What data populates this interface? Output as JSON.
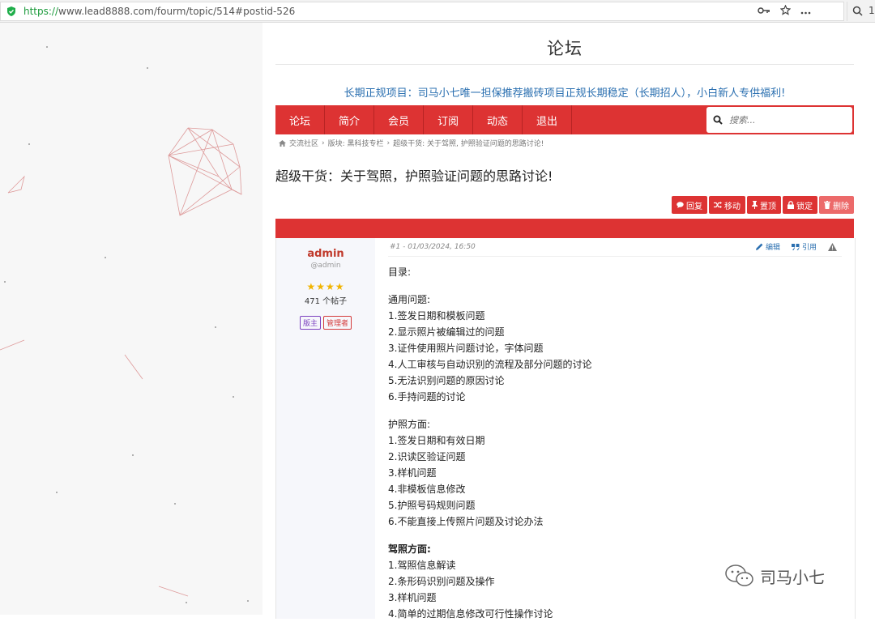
{
  "browser": {
    "url_proto": "https://",
    "url_rest": "www.lead8888.com/fourm/topic/514#postid-526",
    "right_char": "1"
  },
  "site": {
    "title": "论坛",
    "banner": "长期正规项目：司马小七唯一担保推荐搬砖项目正规长期稳定（长期招人），小白新人专供福利!"
  },
  "nav": {
    "items": [
      "论坛",
      "简介",
      "会员",
      "订阅",
      "动态",
      "退出"
    ],
    "search_placeholder": "搜索..."
  },
  "breadcrumb": {
    "home": "交流社区",
    "board": "版块: 黑科技专栏",
    "topic": "超级干货: 关于驾照, 护照验证问题的思路讨论!"
  },
  "topic": {
    "title": "超级干货：关于驾照，护照验证问题的思路讨论!"
  },
  "actions": {
    "reply": "回复",
    "move": "移动",
    "pin": "置顶",
    "lock": "锁定",
    "delete": "删除"
  },
  "author": {
    "name": "admin",
    "handle": "@admin",
    "stars": "★★★★",
    "posts": "471 个帖子",
    "badge_mod": "版主",
    "badge_admin": "管理者"
  },
  "post": {
    "meta": "#1 - 01/03/2024, 16:50",
    "edit": "编辑",
    "quote": "引用",
    "lines": {
      "toc": "目录:",
      "general_h": "通用问题:",
      "g1": "1.签发日期和模板问题",
      "g2": "2.显示照片被编辑过的问题",
      "g3": "3.证件使用照片问题讨论，字体问题",
      "g4": "4.人工审核与自动识别的流程及部分问题的讨论",
      "g5": "5.无法识别问题的原因讨论",
      "g6": "6.手持问题的讨论",
      "passport_h": "护照方面:",
      "p1": "1.签发日期和有效日期",
      "p2": "2.识读区验证问题",
      "p3": "3.样机问题",
      "p4": "4.非模板信息修改",
      "p5": "5.护照号码规则问题",
      "p6": "6.不能直接上传照片问题及讨论办法",
      "license_h": "驾照方面:",
      "l1": "1.驾照信息解读",
      "l2": "2.条形码识别问题及操作",
      "l3": "3.样机问题",
      "l4": "4.简单的过期信息修改可行性操作讨论"
    }
  },
  "watermark": {
    "text": "司马小七"
  },
  "colors": {
    "accent": "#dd3333",
    "link": "#2a6fb0"
  }
}
